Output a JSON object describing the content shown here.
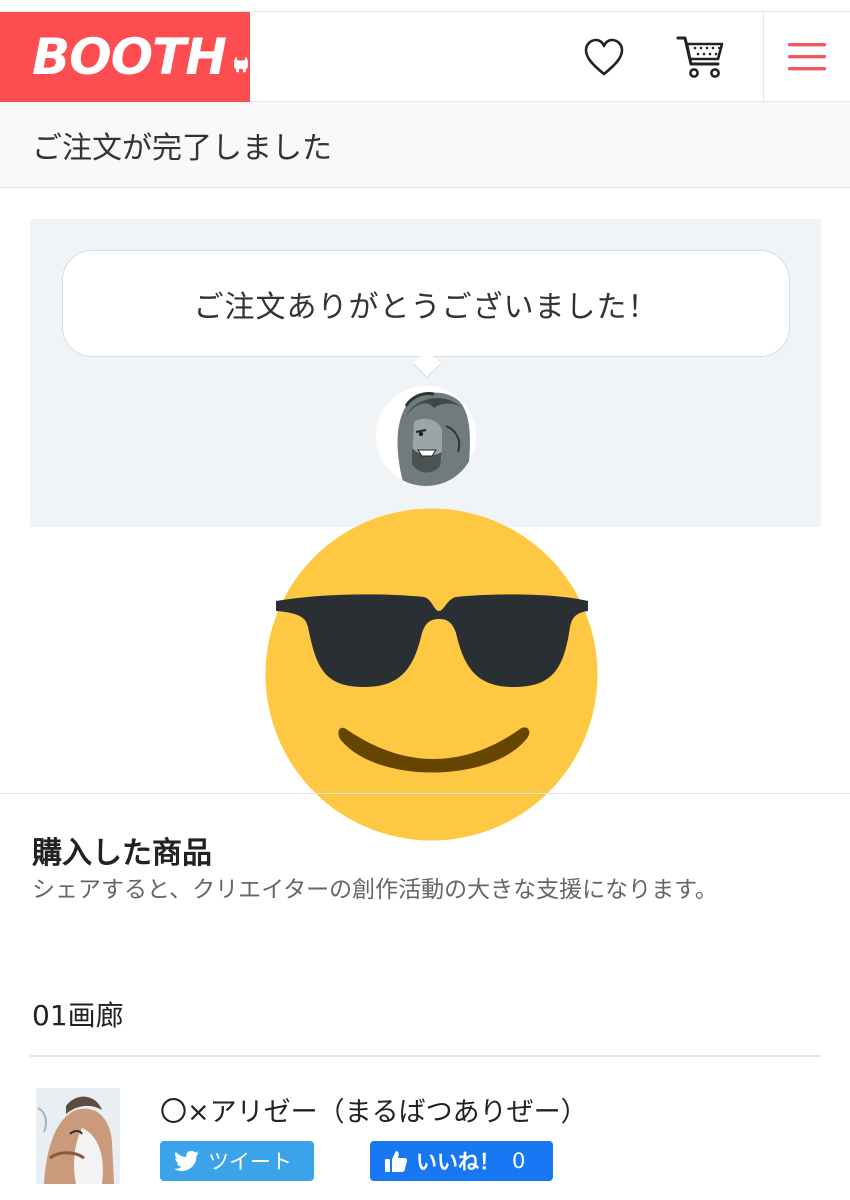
{
  "header": {
    "logo": "BOOTH",
    "brand_color": "#fc4d50",
    "icons": [
      "heart-icon",
      "cart-icon",
      "hamburger-menu-icon"
    ]
  },
  "page_title": "ご注文が完了しました",
  "thanks": {
    "message": "ご注文ありがとうございました！"
  },
  "purchased": {
    "title": "購入した商品",
    "description": "シェアすると、クリエイターの創作活動の大きな支援になります。",
    "shop_name": "01画廊",
    "items": [
      {
        "name": "〇×アリゼー（まるばつありぜー）",
        "tweet_label": "ツイート",
        "like_label": "いいね！",
        "like_count": "0"
      }
    ]
  },
  "colors": {
    "panel_bg": "#f1f4f7",
    "tweet": "#3ba3ea",
    "facebook": "#1877f2"
  }
}
